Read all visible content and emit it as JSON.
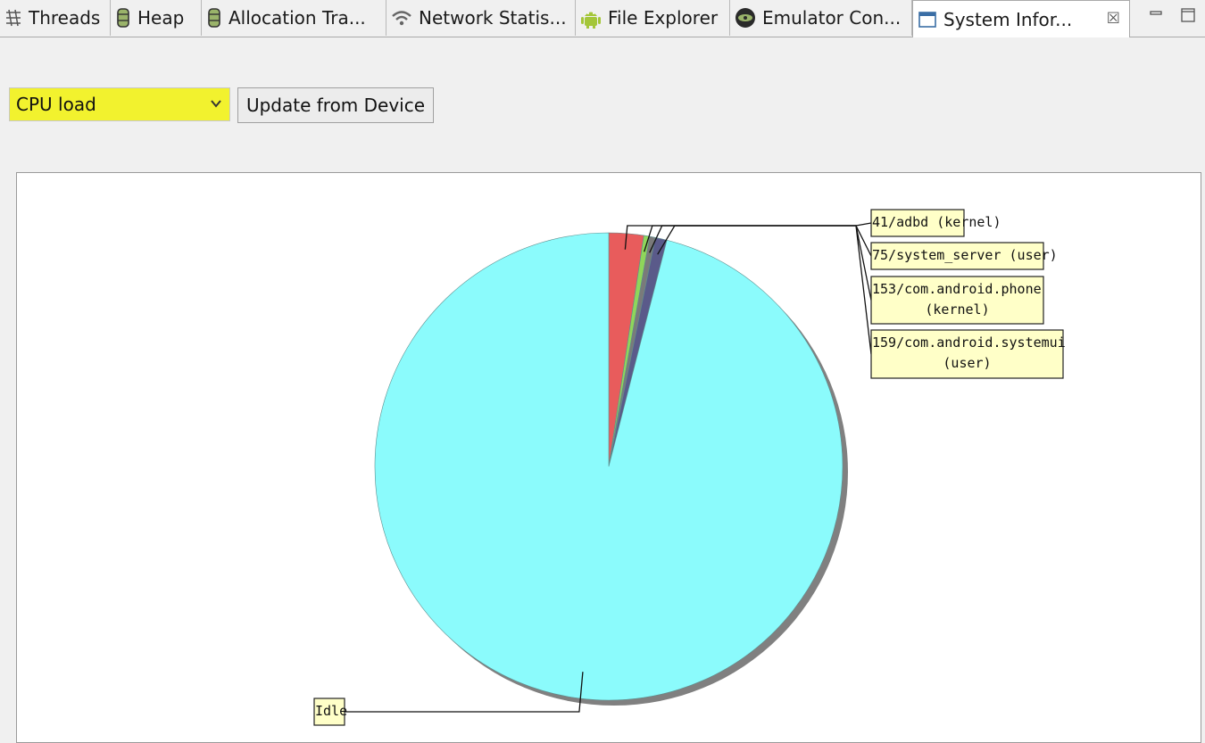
{
  "tabs": [
    {
      "label": "Threads",
      "icon": "threads-icon"
    },
    {
      "label": "Heap",
      "icon": "heap-icon"
    },
    {
      "label": "Allocation Tra...",
      "icon": "allocation-icon"
    },
    {
      "label": "Network Statis...",
      "icon": "wifi-icon"
    },
    {
      "label": "File Explorer",
      "icon": "android-icon"
    },
    {
      "label": "Emulator Con...",
      "icon": "emulator-icon"
    },
    {
      "label": "System Infor...",
      "icon": "window-icon",
      "active": true
    }
  ],
  "tab_close_glyph": "☒",
  "toolbar": {
    "combo_value": "CPU load",
    "update_label": "Update from Device"
  },
  "colors": {
    "highlight": "#f2f22e",
    "idle": "#8bfbfc",
    "adbd": "#e85c5c",
    "system_server": "#8fd65a",
    "phone": "#7a7a7a",
    "systemui": "#5a5a8a",
    "label_bg": "#ffffc8"
  },
  "chart_data": {
    "type": "pie",
    "labels": [
      "41/adbd (kernel)",
      "75/system_server (user)",
      "153/com.android.phone (kernel)",
      "159/com.android.systemui (user)",
      "Idle"
    ],
    "label_lines": [
      [
        "41/adbd (kernel)"
      ],
      [
        "75/system_server (user)"
      ],
      [
        "153/com.android.phone",
        "(kernel)"
      ],
      [
        "159/com.android.systemui",
        "(user)"
      ],
      [
        "Idle"
      ]
    ],
    "values": [
      2.4,
      0.4,
      0.4,
      0.8,
      96.0
    ],
    "series_colors": [
      "#e85c5c",
      "#8fd65a",
      "#7a7a7a",
      "#5a5a8a",
      "#8bfbfc"
    ]
  }
}
